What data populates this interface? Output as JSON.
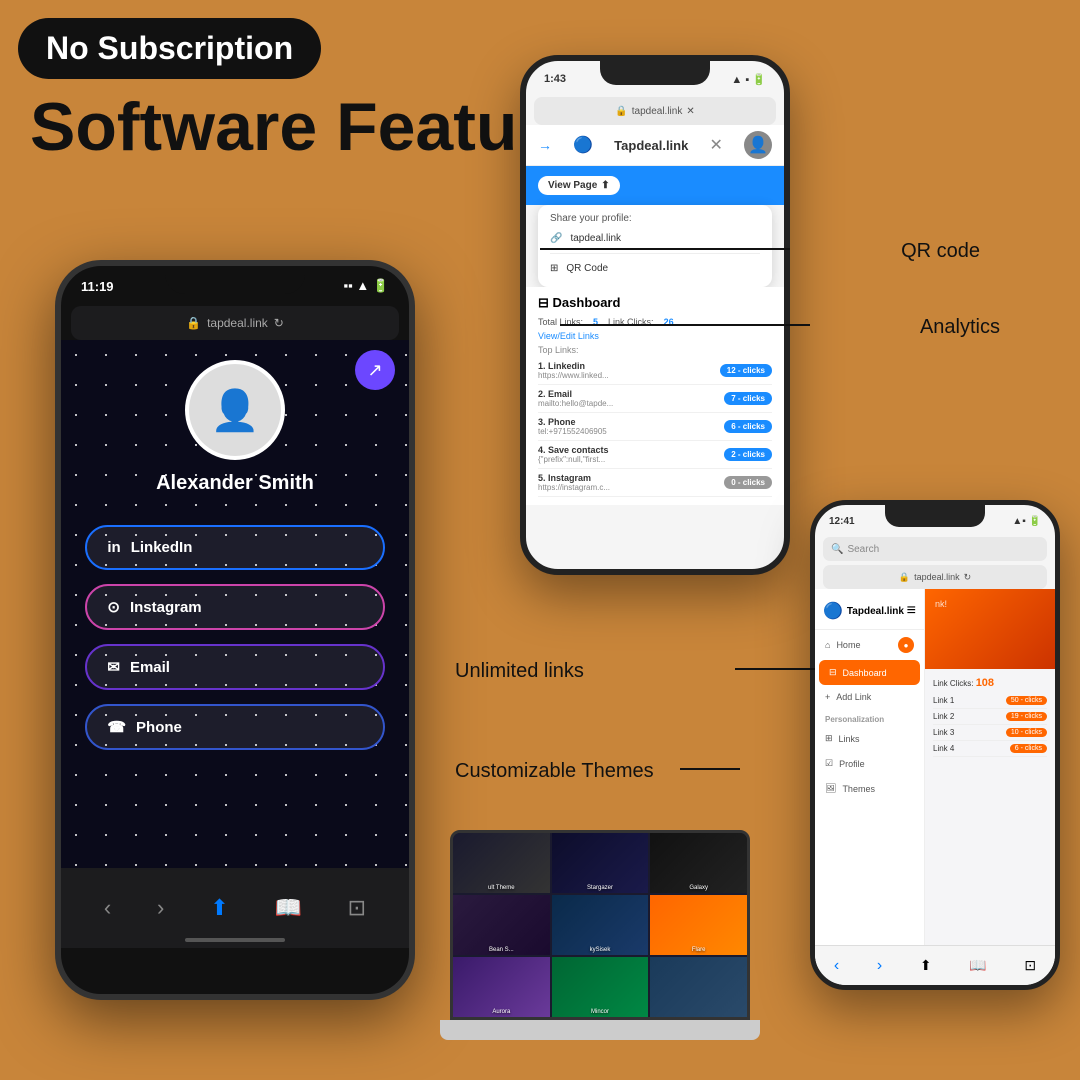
{
  "badge": {
    "text": "No Subscription"
  },
  "heading": {
    "line1": "Software Features"
  },
  "phone_left": {
    "time": "11:19",
    "url": "tapdeal.link",
    "user_name": "Alexander Smith",
    "links": [
      {
        "icon": "in",
        "label": "LinkedIn",
        "style": "linkedin"
      },
      {
        "icon": "ig",
        "label": "Instagram",
        "style": "instagram"
      },
      {
        "icon": "✉",
        "label": "Email",
        "style": "email"
      },
      {
        "icon": "☎",
        "label": "Phone",
        "style": "phone"
      }
    ]
  },
  "phone_top": {
    "time": "1:43",
    "url": "tapdeal.link",
    "app_title": "Tapdeal.link",
    "view_page_btn": "View Page",
    "share_label": "Share your profile:",
    "share_link": "tapdeal.link",
    "qr_label": "QR Code",
    "dashboard_title": "Dashboard",
    "total_links_label": "Total Links:",
    "total_links_val": "5",
    "link_clicks_label": "Link Clicks:",
    "link_clicks_val": "26",
    "view_edit": "View/Edit Links",
    "top_links": "Top Links:",
    "links": [
      {
        "num": "1",
        "name": "Linkedin",
        "url": "https://www.linked...",
        "clicks": "12 - clicks"
      },
      {
        "num": "2",
        "name": "Email",
        "url": "mailto:hello@tapde...",
        "clicks": "7 - clicks"
      },
      {
        "num": "3",
        "name": "Phone",
        "url": "tel:+971552406905",
        "clicks": "6 - clicks"
      },
      {
        "num": "4",
        "name": "Save contacts",
        "url": "{\"prefix\":null,\"first...",
        "clicks": "2 - clicks"
      },
      {
        "num": "5",
        "name": "Instagram",
        "url": "https://instagram.c...",
        "clicks": "0 - clicks"
      }
    ]
  },
  "phone_right": {
    "time": "12:41",
    "url": "tapdeal.link",
    "app_title": "Tapdeal.link",
    "sidebar": {
      "home": "Home",
      "dashboard": "Dashboard",
      "add_link": "Add Link",
      "personalization": "Personalization",
      "links": "Links",
      "profile": "Profile",
      "themes": "Themes"
    },
    "link_clicks_label": "Link Clicks:",
    "link_clicks_val": "108",
    "links": [
      {
        "clicks": "50 - clicks"
      },
      {
        "clicks": "19 - clicks"
      },
      {
        "clicks": "10 - clicks"
      },
      {
        "clicks": "6 - clicks"
      }
    ]
  },
  "themes_laptop": {
    "themes": [
      {
        "name": "ult Theme",
        "class": "theme-default"
      },
      {
        "name": "Stargazer",
        "class": "theme-stargazer"
      },
      {
        "name": "Galaxy",
        "class": "theme-galaxy"
      },
      {
        "name": "Bean S...",
        "class": "theme-bean"
      },
      {
        "name": "kySisek",
        "class": "theme-skysek"
      },
      {
        "name": "Flare",
        "class": "theme-flare"
      },
      {
        "name": "Aurora",
        "class": "theme-aurora"
      },
      {
        "name": "Mincor",
        "class": "theme-mincor"
      },
      {
        "name": "",
        "class": "theme-extra"
      }
    ]
  },
  "annotations": {
    "qr_code": "QR code",
    "analytics": "Analytics",
    "unlimited_links": "Unlimited links",
    "customizable_themes": "Customizable Themes"
  }
}
